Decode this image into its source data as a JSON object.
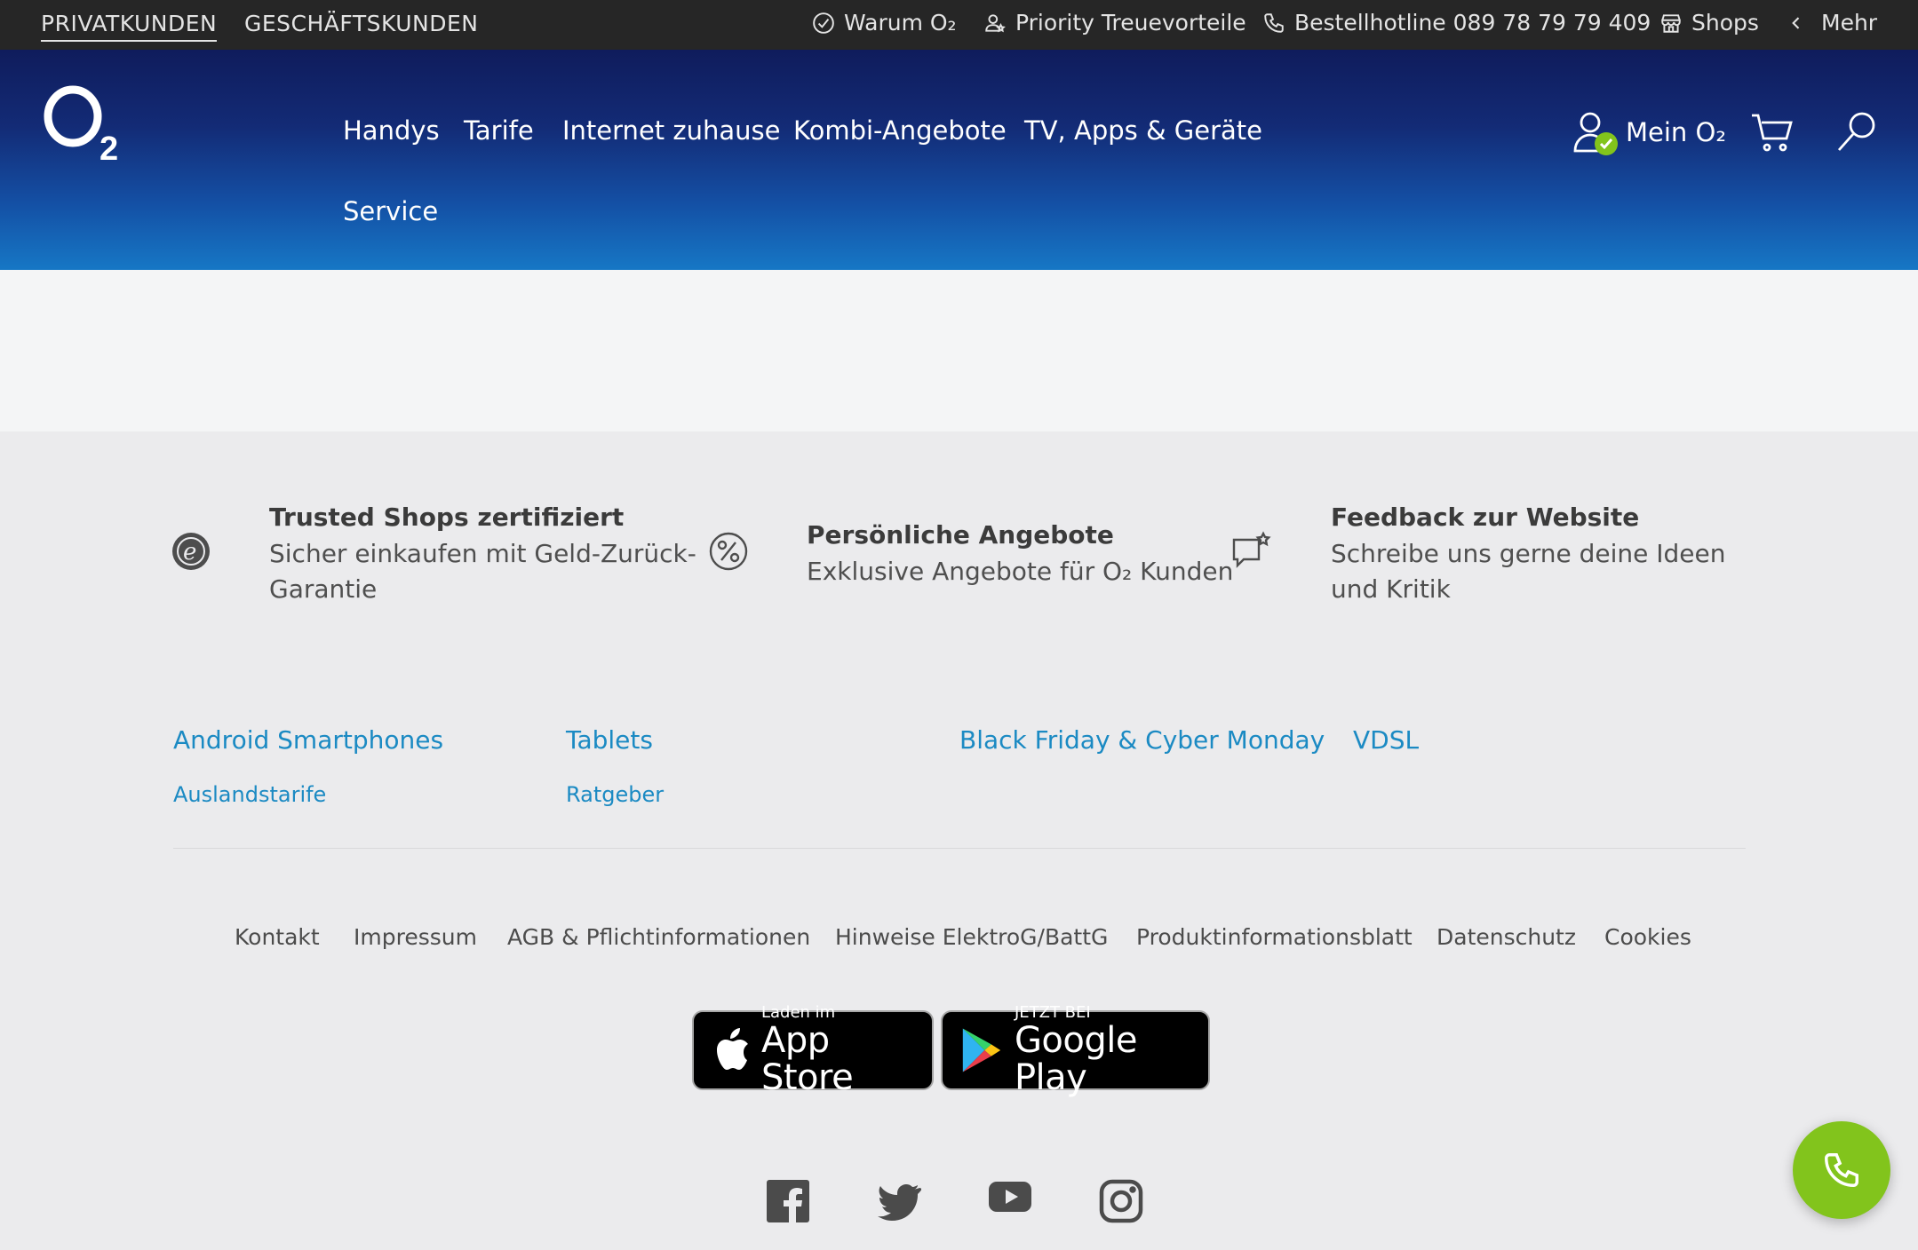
{
  "topbar": {
    "segments": [
      "PRIVATKUNDEN",
      "GESCHÄFTSKUNDEN"
    ],
    "utilities": [
      {
        "icon": "check-circle-icon",
        "label": "Warum O₂"
      },
      {
        "icon": "person-star-icon",
        "label": "Priority Treuevorteile"
      },
      {
        "icon": "phone-icon",
        "label": "Bestellhotline 089 78 79 79 409"
      },
      {
        "icon": "store-icon",
        "label": "Shops"
      },
      {
        "icon": "chevron-left-icon",
        "label": "Mehr"
      }
    ]
  },
  "header": {
    "logo": "O₂",
    "nav": [
      "Handys",
      "Tarife",
      "Internet zuhause",
      "Kombi-Angebote",
      "TV, Apps & Geräte",
      "Service"
    ],
    "account_label": "Mein O₂",
    "icons": [
      "user-check-icon",
      "cart-icon",
      "search-icon"
    ]
  },
  "trust": [
    {
      "icon": "trusted-shops-icon",
      "title": "Trusted Shops zertifiziert",
      "line1": "Sicher einkaufen mit Geld-Zurück-",
      "line2": "Garantie"
    },
    {
      "icon": "percent-icon",
      "title": "Persönliche Angebote",
      "line1": "Exklusive Angebote für O₂ Kunden",
      "line2": ""
    },
    {
      "icon": "feedback-icon",
      "title": "Feedback zur Website",
      "line1": "Schreibe uns gerne deine Ideen",
      "line2": "und Kritik"
    }
  ],
  "links": {
    "large": [
      "Android Smartphones",
      "Tablets",
      "Black Friday & Cyber Monday",
      "VDSL"
    ],
    "small": [
      "Auslandstarife",
      "Ratgeber"
    ]
  },
  "legal": [
    "Kontakt",
    "Impressum",
    "AGB & Pflichtinformationen",
    "Hinweise ElektroG/BattG",
    "Produktinformationsblatt",
    "Datenschutz",
    "Cookies"
  ],
  "badges": {
    "appstore": {
      "small": "Laden im",
      "big": "App Store"
    },
    "googleplay": {
      "small": "JETZT BEI",
      "big": "Google Play"
    }
  },
  "social": [
    "facebook-icon",
    "twitter-icon",
    "youtube-icon",
    "instagram-icon"
  ],
  "fab": {
    "icon": "phone-icon"
  },
  "colors": {
    "accent_link": "#1b8ac3",
    "fab_green": "#82c41c",
    "header_top": "#0f1c5c",
    "header_bottom": "#1677c5"
  }
}
